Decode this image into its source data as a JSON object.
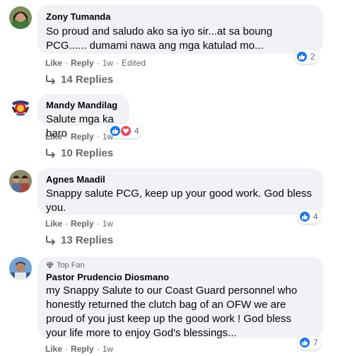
{
  "comments": [
    {
      "author": "Zony Tumanda",
      "text": "So proud and saludo ako sa iyo sir...at sa boung PCG...... dumami nawa ang mga katulad mo...",
      "actions": {
        "like": "Like",
        "reply": "Reply",
        "time": "1w",
        "edited": "Edited"
      },
      "reaction_count": "2",
      "replies_label": "14 Replies"
    },
    {
      "author": "Mandy Mandilag",
      "text": "Salute mga ka baro",
      "actions": {
        "like": "Like",
        "reply": "Reply",
        "time": "1w"
      },
      "reaction_count": "4",
      "replies_label": "10 Replies"
    },
    {
      "author": "Agnes Maadil",
      "text": "Snappy salute PCG, keep up your good work. God bless you.",
      "actions": {
        "like": "Like",
        "reply": "Reply",
        "time": "1w"
      },
      "reaction_count": "4",
      "replies_label": "13 Replies"
    },
    {
      "badge": "Top Fan",
      "author": "Pastor Prudencio Diosmano",
      "text": "my Snappy Salute to our Coast Guard personnel who honestly returned the clutch bag of an OFW we are proud of you just keep up the good work ! God bless your life more to enjoy God's blessings...",
      "actions": {
        "like": "Like",
        "reply": "Reply",
        "time": "1w"
      },
      "reaction_count": "7"
    }
  ],
  "colors": {
    "like_blue": "#1877f2",
    "love_red": "#f33e58",
    "bubble_bg": "#f0f2f5",
    "meta_gray": "#65676b"
  },
  "icons": {
    "like": "thumbs-up-icon",
    "love": "heart-icon",
    "reply_arrow": "reply-arrow-icon",
    "top_fan": "diamond-icon"
  }
}
